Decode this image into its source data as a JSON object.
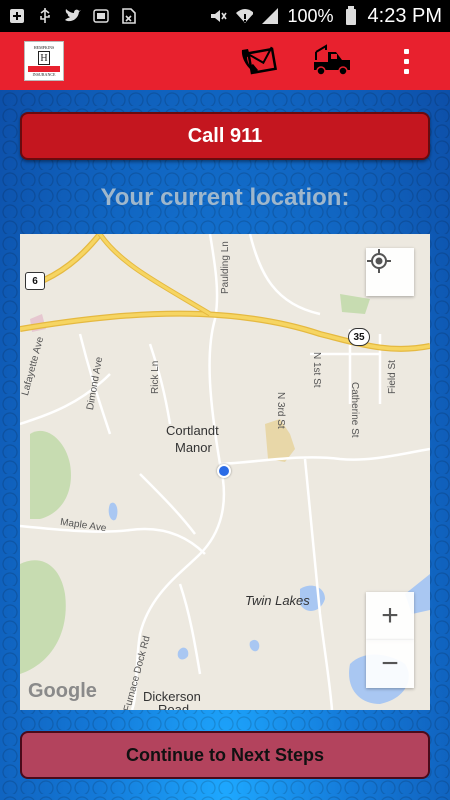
{
  "status_bar": {
    "battery_percent": "100%",
    "time": "4:23 PM",
    "icons": [
      "plus-box-icon",
      "usb-icon",
      "twitter-icon",
      "battery-box-icon",
      "sim-off-icon",
      "mute-icon",
      "wifi-icon",
      "signal-icon",
      "battery-icon"
    ]
  },
  "app_bar": {
    "logo_top": "HEMPKINS",
    "logo_letter": "H",
    "logo_bottom": "INSURANCE",
    "actions": [
      "phone-mail-icon",
      "tow-truck-icon",
      "overflow-menu-icon"
    ]
  },
  "call_button": {
    "label": "Call 911"
  },
  "location_title": "Your current location:",
  "map": {
    "labels": {
      "cortlandt": "Cortlandt",
      "manor": "Manor",
      "twin_lakes": "Twin Lakes",
      "dickerson": "Dickerson",
      "dickerson_road": "Road",
      "maple_ave": "Maple Ave",
      "paulding_ln": "Paulding Ln",
      "lafayette_ave": "Lafayette Ave",
      "dimond_ave": "Dimond Ave",
      "rick_ln": "Rick Ln",
      "n3rd": "N 3rd St",
      "n1st": "N 1st St",
      "catherine_st": "Catherine St",
      "field_st": "Field St",
      "furnace_dock": "Furnace Dock Rd"
    },
    "route_6": "6",
    "route_35": "35",
    "attribution": "Google",
    "zoom_in": "+",
    "zoom_out": "−"
  },
  "continue_button": {
    "label": "Continue to Next Steps"
  },
  "colors": {
    "app_bar": "#e8212e",
    "call_button": "#c4161f",
    "continue_button": "#b3435d",
    "location_dot": "#2a6be6"
  }
}
